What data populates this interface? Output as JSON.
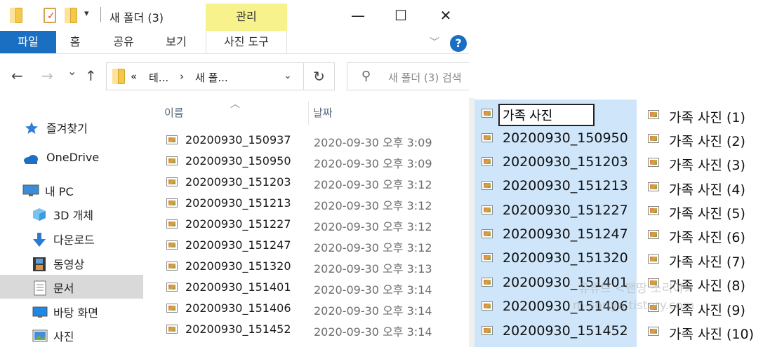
{
  "window": {
    "title": "새 폴더 (3)",
    "manage_tab": "관리",
    "controls": {
      "minimize": "—",
      "maximize": "☐",
      "close": "✕"
    },
    "qa_dropdown": "▾"
  },
  "ribbon": {
    "tabs": [
      "파일",
      "홈",
      "공유",
      "보기",
      "사진 도구"
    ],
    "help": "?",
    "collapse": "﹀"
  },
  "nav": {
    "back": "←",
    "forward": "→",
    "recent": "⌄",
    "up": "↑",
    "address": {
      "overflow": "«",
      "part1": "테...",
      "sep": "›",
      "part2": "새 폴..."
    },
    "address_dropdown": "⌄",
    "refresh": "↻",
    "search_placeholder": "새 폴더 (3) 검색"
  },
  "sidebar": {
    "items": [
      {
        "label": "즐겨찾기",
        "icon": "star-icon"
      },
      {
        "label": "OneDrive",
        "icon": "cloud-icon"
      },
      {
        "label": "내 PC",
        "icon": "computer-icon"
      },
      {
        "label": "3D 개체",
        "icon": "cube-icon"
      },
      {
        "label": "다운로드",
        "icon": "download-icon"
      },
      {
        "label": "동영상",
        "icon": "film-icon"
      },
      {
        "label": "문서",
        "icon": "document-icon",
        "selected": true
      },
      {
        "label": "바탕 화면",
        "icon": "desktop-icon"
      },
      {
        "label": "사진",
        "icon": "pictures-icon"
      }
    ]
  },
  "list": {
    "sort_indicator": "︿",
    "columns": {
      "name": "이름",
      "date": "날짜"
    },
    "rows": [
      {
        "name": "20200930_150937",
        "date": "2020-09-30 오후 3:09"
      },
      {
        "name": "20200930_150950",
        "date": "2020-09-30 오후 3:09"
      },
      {
        "name": "20200930_151203",
        "date": "2020-09-30 오후 3:12"
      },
      {
        "name": "20200930_151213",
        "date": "2020-09-30 오후 3:12"
      },
      {
        "name": "20200930_151227",
        "date": "2020-09-30 오후 3:12"
      },
      {
        "name": "20200930_151247",
        "date": "2020-09-30 오후 3:12"
      },
      {
        "name": "20200930_151320",
        "date": "2020-09-30 오후 3:13"
      },
      {
        "name": "20200930_151401",
        "date": "2020-09-30 오후 3:14"
      },
      {
        "name": "20200930_151406",
        "date": "2020-09-30 오후 3:14"
      },
      {
        "name": "20200930_151452",
        "date": "2020-09-30 오후 3:14"
      }
    ]
  },
  "rename": {
    "editing_value": "가족 사진",
    "rows": [
      "20200930_150950",
      "20200930_151203",
      "20200930_151213",
      "20200930_151227",
      "20200930_151247",
      "20200930_151320",
      "20200930_151401",
      "20200930_151406",
      "20200930_151452"
    ]
  },
  "results": {
    "rows": [
      "가족 사진 (1)",
      "가족 사진 (2)",
      "가족 사진 (3)",
      "가족 사진 (4)",
      "가족 사진 (5)",
      "가족 사진 (6)",
      "가족 사진 (7)",
      "가족 사진 (8)",
      "가족 사진 (9)",
      "가족 사진 (10)"
    ]
  },
  "watermark": {
    "line1": "유튜브 <맨땅 소리야>",
    "line2": "m-soriya.tistory.com"
  }
}
